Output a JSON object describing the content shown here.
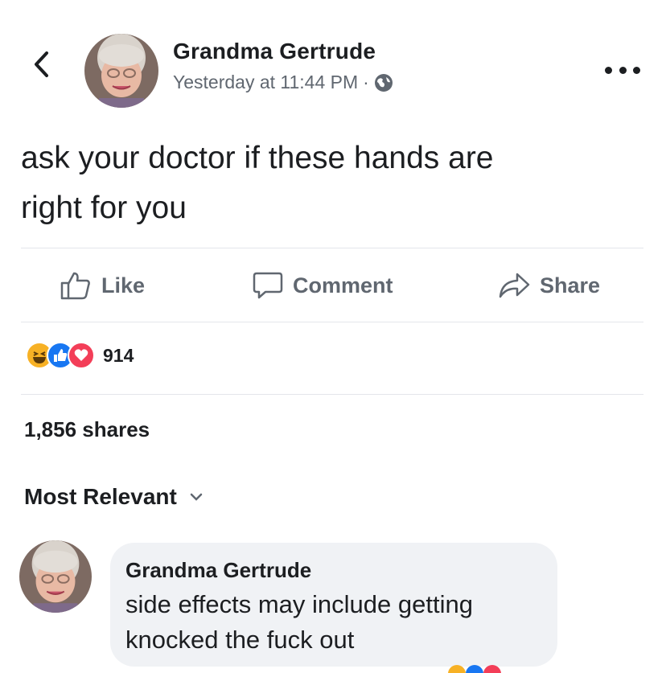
{
  "header": {
    "author_name": "Grandma Gertrude",
    "timestamp": "Yesterday at 11:44 PM",
    "separator": "·",
    "back_icon": "chevron-left-icon",
    "audience_icon": "globe-icon",
    "more_icon": "more-horizontal-icon"
  },
  "post": {
    "text_line1": "ask your doctor if these hands are",
    "text_line2": "right for you"
  },
  "actions": {
    "like_label": "Like",
    "comment_label": "Comment",
    "share_label": "Share"
  },
  "reactions": {
    "types": [
      "haha",
      "like",
      "love"
    ],
    "count": "914"
  },
  "shares": {
    "label": "1,856 shares"
  },
  "comments": {
    "sort_label": "Most Relevant",
    "items": [
      {
        "author": "Grandma Gertrude",
        "text": "side effects may include getting knocked the fuck out"
      }
    ]
  },
  "colors": {
    "text_primary": "#1c1e21",
    "text_secondary": "#606770",
    "divider": "#e4e6eb",
    "bubble_bg": "#f0f2f5",
    "like_blue": "#1877f2",
    "love_red": "#f33e58",
    "haha_yellow": "#f7b125"
  }
}
